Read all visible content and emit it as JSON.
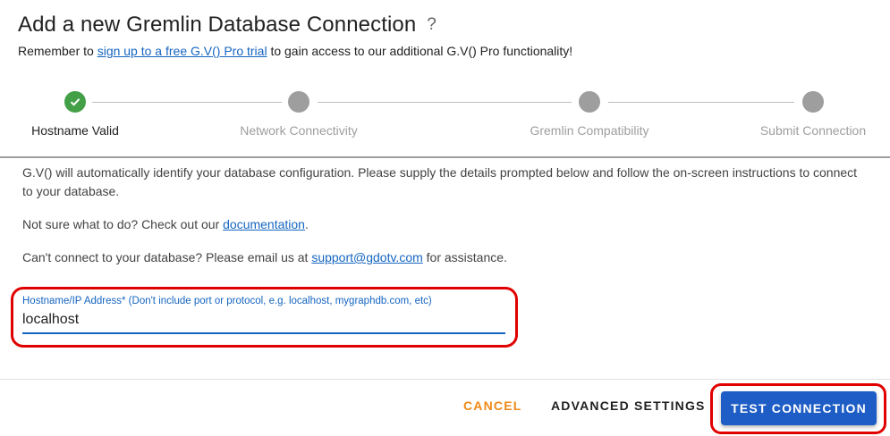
{
  "header": {
    "title": "Add a new Gremlin Database Connection",
    "help_icon": "?",
    "subtitle_prefix": "Remember to ",
    "subtitle_link": "sign up to a free G.V() Pro trial",
    "subtitle_suffix": " to gain access to our additional G.V() Pro functionality!"
  },
  "stepper": {
    "steps": [
      {
        "label": "Hostname Valid",
        "state": "complete",
        "icon": "check-icon"
      },
      {
        "label": "Network Connectivity",
        "state": "pending"
      },
      {
        "label": "Gremlin Compatibility",
        "state": "pending"
      },
      {
        "label": "Submit Connection",
        "state": "pending"
      }
    ]
  },
  "content": {
    "intro": "G.V() will automatically identify your database configuration. Please supply the details prompted below and follow the on-screen instructions to connect to your database.",
    "docs_prefix": "Not sure what to do? Check out our ",
    "docs_link": "documentation",
    "docs_suffix": ".",
    "support_prefix": "Can't connect to your database? Please email us at ",
    "support_link": "support@gdotv.com",
    "support_suffix": " for assistance."
  },
  "form": {
    "hostname_label": "Hostname/IP Address* (Don't include port or protocol, e.g. localhost, mygraphdb.com, etc)",
    "hostname_value": "localhost"
  },
  "footer": {
    "cancel_label": "CANCEL",
    "advanced_label": "ADVANCED SETTINGS",
    "test_label": "TEST CONNECTION"
  },
  "colors": {
    "accent": "#1e5dc6",
    "cancel": "#ef8a17",
    "complete": "#43a047",
    "pending": "#9e9e9e",
    "highlight": "#e10000"
  }
}
